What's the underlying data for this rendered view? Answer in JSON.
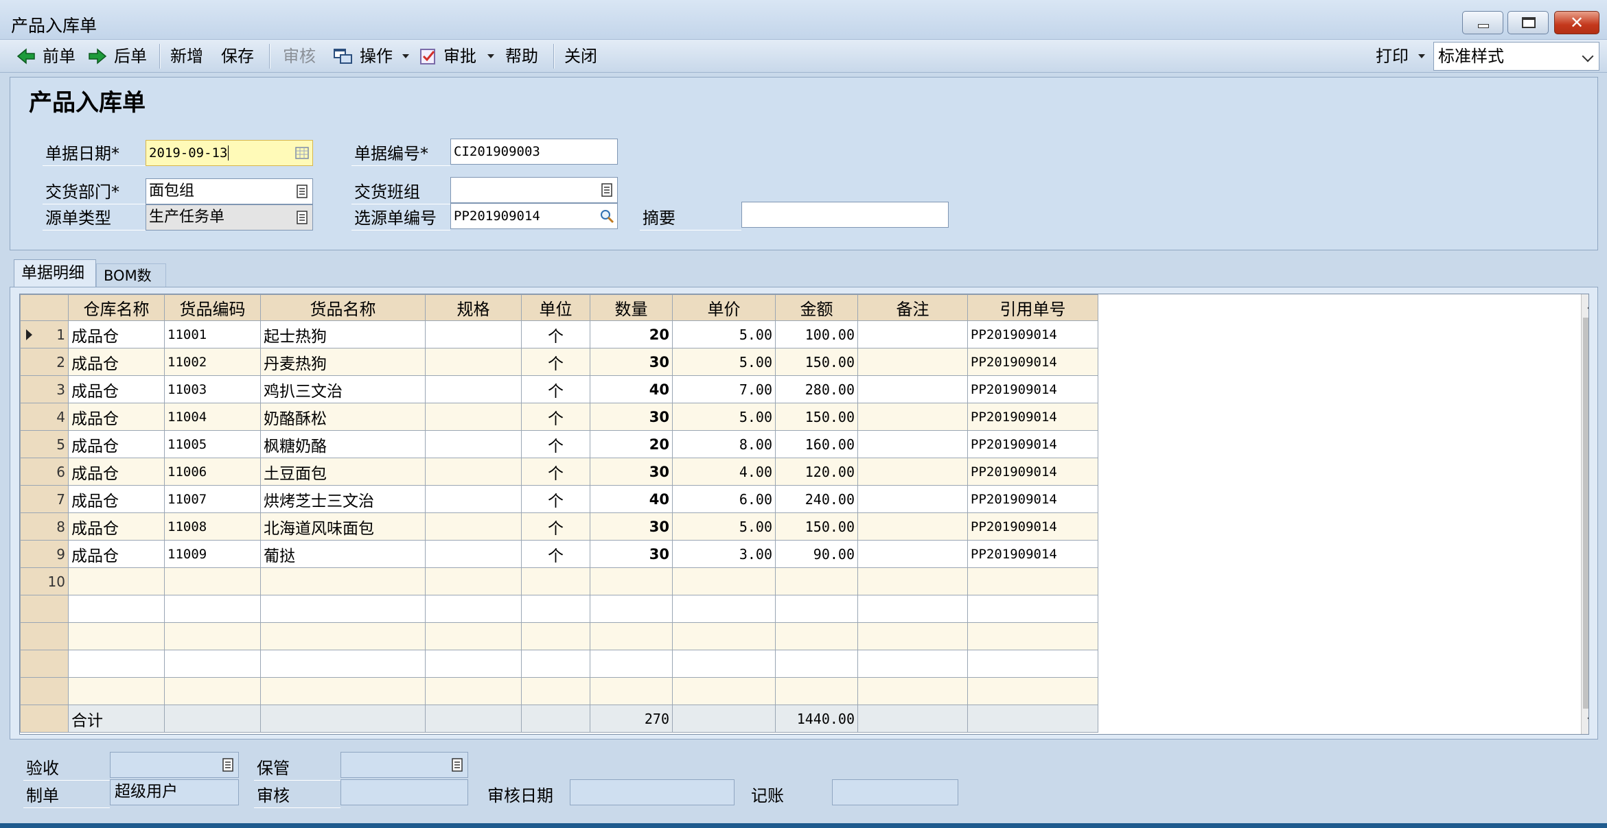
{
  "window": {
    "title": "产品入库单"
  },
  "toolbar": {
    "prev": "前单",
    "next": "后单",
    "new": "新增",
    "save": "保存",
    "review": "审核",
    "operate": "操作",
    "approve": "审批",
    "help": "帮助",
    "close": "关闭",
    "print": "打印",
    "style_value": "标准样式"
  },
  "form": {
    "title": "产品入库单",
    "date_label": "单据日期*",
    "date_value": "2019-09-13",
    "docno_label": "单据编号*",
    "docno_value": "CI201909003",
    "dept_label": "交货部门*",
    "dept_value": "面包组",
    "team_label": "交货班组",
    "team_value": "",
    "srctype_label": "源单类型",
    "srctype_value": "生产任务单",
    "srcno_label": "选源单编号",
    "srcno_value": "PP201909014",
    "summary_label": "摘要",
    "summary_value": ""
  },
  "tabs": [
    "单据明细",
    "BOM数据"
  ],
  "grid": {
    "columns": [
      "仓库名称",
      "货品编码",
      "货品名称",
      "规格",
      "单位",
      "数量",
      "单价",
      "金额",
      "备注",
      "引用单号"
    ],
    "rows": [
      {
        "no": "1",
        "warehouse": "成品仓",
        "code": "11001",
        "name": "起士热狗",
        "spec": "",
        "unit": "个",
        "qty": "20",
        "price": "5.00",
        "amount": "100.00",
        "remark": "",
        "ref": "PP201909014"
      },
      {
        "no": "2",
        "warehouse": "成品仓",
        "code": "11002",
        "name": "丹麦热狗",
        "spec": "",
        "unit": "个",
        "qty": "30",
        "price": "5.00",
        "amount": "150.00",
        "remark": "",
        "ref": "PP201909014"
      },
      {
        "no": "3",
        "warehouse": "成品仓",
        "code": "11003",
        "name": "鸡扒三文治",
        "spec": "",
        "unit": "个",
        "qty": "40",
        "price": "7.00",
        "amount": "280.00",
        "remark": "",
        "ref": "PP201909014"
      },
      {
        "no": "4",
        "warehouse": "成品仓",
        "code": "11004",
        "name": "奶酪酥松",
        "spec": "",
        "unit": "个",
        "qty": "30",
        "price": "5.00",
        "amount": "150.00",
        "remark": "",
        "ref": "PP201909014"
      },
      {
        "no": "5",
        "warehouse": "成品仓",
        "code": "11005",
        "name": "枫糖奶酪",
        "spec": "",
        "unit": "个",
        "qty": "20",
        "price": "8.00",
        "amount": "160.00",
        "remark": "",
        "ref": "PP201909014"
      },
      {
        "no": "6",
        "warehouse": "成品仓",
        "code": "11006",
        "name": "土豆面包",
        "spec": "",
        "unit": "个",
        "qty": "30",
        "price": "4.00",
        "amount": "120.00",
        "remark": "",
        "ref": "PP201909014"
      },
      {
        "no": "7",
        "warehouse": "成品仓",
        "code": "11007",
        "name": "烘烤芝士三文治",
        "spec": "",
        "unit": "个",
        "qty": "40",
        "price": "6.00",
        "amount": "240.00",
        "remark": "",
        "ref": "PP201909014"
      },
      {
        "no": "8",
        "warehouse": "成品仓",
        "code": "11008",
        "name": "北海道风味面包",
        "spec": "",
        "unit": "个",
        "qty": "30",
        "price": "5.00",
        "amount": "150.00",
        "remark": "",
        "ref": "PP201909014"
      },
      {
        "no": "9",
        "warehouse": "成品仓",
        "code": "11009",
        "name": "葡挞",
        "spec": "",
        "unit": "个",
        "qty": "30",
        "price": "3.00",
        "amount": "90.00",
        "remark": "",
        "ref": "PP201909014"
      },
      {
        "no": "10",
        "warehouse": "",
        "code": "",
        "name": "",
        "spec": "",
        "unit": "",
        "qty": "",
        "price": "",
        "amount": "",
        "remark": "",
        "ref": ""
      },
      {
        "no": "",
        "warehouse": "",
        "code": "",
        "name": "",
        "spec": "",
        "unit": "",
        "qty": "",
        "price": "",
        "amount": "",
        "remark": "",
        "ref": ""
      },
      {
        "no": "",
        "warehouse": "",
        "code": "",
        "name": "",
        "spec": "",
        "unit": "",
        "qty": "",
        "price": "",
        "amount": "",
        "remark": "",
        "ref": ""
      },
      {
        "no": "",
        "warehouse": "",
        "code": "",
        "name": "",
        "spec": "",
        "unit": "",
        "qty": "",
        "price": "",
        "amount": "",
        "remark": "",
        "ref": ""
      },
      {
        "no": "",
        "warehouse": "",
        "code": "",
        "name": "",
        "spec": "",
        "unit": "",
        "qty": "",
        "price": "",
        "amount": "",
        "remark": "",
        "ref": ""
      }
    ],
    "total": {
      "label": "合计",
      "qty": "270",
      "amount": "1440.00"
    }
  },
  "footer": {
    "accept_label": "验收",
    "accept_value": "",
    "custody_label": "保管",
    "custody_value": "",
    "maker_label": "制单",
    "maker_value": "超级用户",
    "reviewer_label": "审核",
    "reviewer_value": "",
    "review_date_label": "审核日期",
    "review_date_value": "",
    "bookkeep_label": "记账",
    "bookkeep_value": ""
  },
  "colors": {
    "window_bg": "#c9d9ea",
    "header_cell": "#ecdcc0",
    "focus_input": "#fffab8",
    "close_button": "#c4381c"
  }
}
